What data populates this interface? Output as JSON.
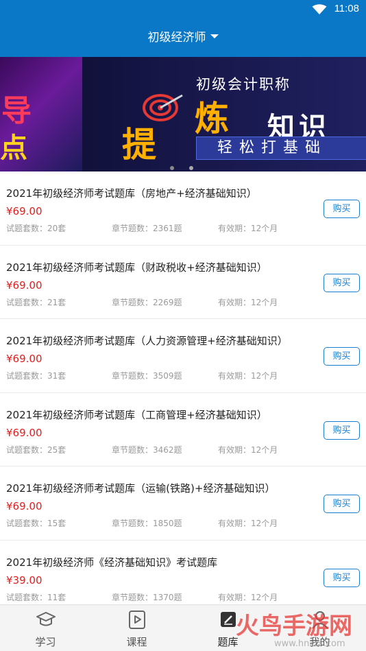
{
  "status_bar": {
    "time": "11:08"
  },
  "header": {
    "title": "初级经济师"
  },
  "banner": {
    "left_line1": "导",
    "left_line2": "点",
    "right_title": "初级会计职称",
    "hero_char1": "提",
    "hero_char2": "炼",
    "hero_text": "知识",
    "subtitle": "轻松打基础"
  },
  "items": [
    {
      "title": "2021年初级经济师考试题库（房地产+经济基础知识）",
      "price": "¥69.00",
      "sets": "试题套数：20套",
      "chapters": "章节题数：2361题",
      "validity": "有效期：12个月",
      "buy": "购买"
    },
    {
      "title": "2021年初级经济师考试题库（财政税收+经济基础知识）",
      "price": "¥69.00",
      "sets": "试题套数：21套",
      "chapters": "章节题数：2269题",
      "validity": "有效期：12个月",
      "buy": "购买"
    },
    {
      "title": "2021年初级经济师考试题库（人力资源管理+经济基础知识）",
      "price": "¥69.00",
      "sets": "试题套数：31套",
      "chapters": "章节题数：3509题",
      "validity": "有效期：12个月",
      "buy": "购买"
    },
    {
      "title": "2021年初级经济师考试题库（工商管理+经济基础知识）",
      "price": "¥69.00",
      "sets": "试题套数：25套",
      "chapters": "章节题数：3462题",
      "validity": "有效期：12个月",
      "buy": "购买"
    },
    {
      "title": "2021年初级经济师考试题库（运输(铁路)+经济基础知识）",
      "price": "¥69.00",
      "sets": "试题套数：15套",
      "chapters": "章节题数：1850题",
      "validity": "有效期：12个月",
      "buy": "购买"
    },
    {
      "title": "2021年初级经济师《经济基础知识》考试题库",
      "price": "¥39.00",
      "sets": "试题套数：11套",
      "chapters": "章节题数：1370题",
      "validity": "有效期：12个月",
      "buy": "购买"
    }
  ],
  "tabbar": {
    "tabs": [
      {
        "label": "学习",
        "icon": "graduation-cap-icon"
      },
      {
        "label": "课程",
        "icon": "play-video-icon"
      },
      {
        "label": "题库",
        "icon": "edit-note-icon"
      },
      {
        "label": "我的",
        "icon": "person-icon"
      }
    ]
  },
  "watermark": {
    "text": "火鸟手游网",
    "url_text": "www.hnzzs.com"
  },
  "colors": {
    "primary": "#0a78c6",
    "price": "#e02020",
    "button": "#1a7fd0"
  }
}
